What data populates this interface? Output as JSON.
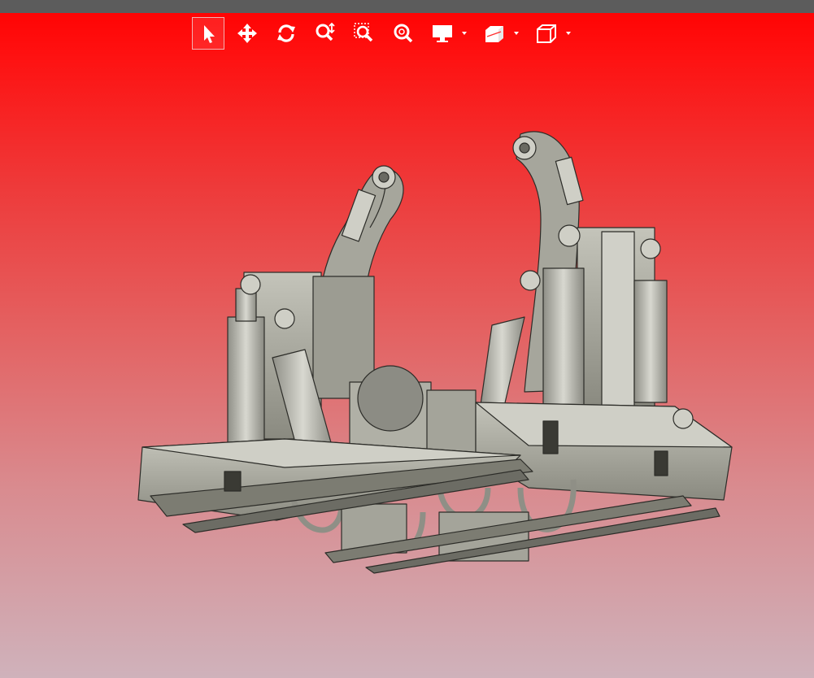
{
  "toolbar": {
    "tools": [
      {
        "name": "select",
        "icon": "cursor-arrow-icon",
        "active": true
      },
      {
        "name": "pan",
        "icon": "move-arrows-icon",
        "active": false
      },
      {
        "name": "rotate",
        "icon": "rotate-icon",
        "active": false
      },
      {
        "name": "zoom",
        "icon": "zoom-vertical-icon",
        "active": false
      },
      {
        "name": "zoom-window",
        "icon": "zoom-window-icon",
        "active": false
      },
      {
        "name": "zoom-fit",
        "icon": "zoom-fit-icon",
        "active": false
      },
      {
        "name": "display-mode",
        "icon": "monitor-icon",
        "dropdown": true
      },
      {
        "name": "section",
        "icon": "section-cube-icon",
        "dropdown": true
      },
      {
        "name": "view-orientation",
        "icon": "cube-view-icon",
        "dropdown": true
      }
    ]
  },
  "colors": {
    "background_top": "#ff0000",
    "background_bottom": "#cfb2bb",
    "titlebar": "#5c5c5c",
    "icon": "#ffffff",
    "model_metal": "#b8b8ae",
    "model_dark": "#5a5a52"
  }
}
